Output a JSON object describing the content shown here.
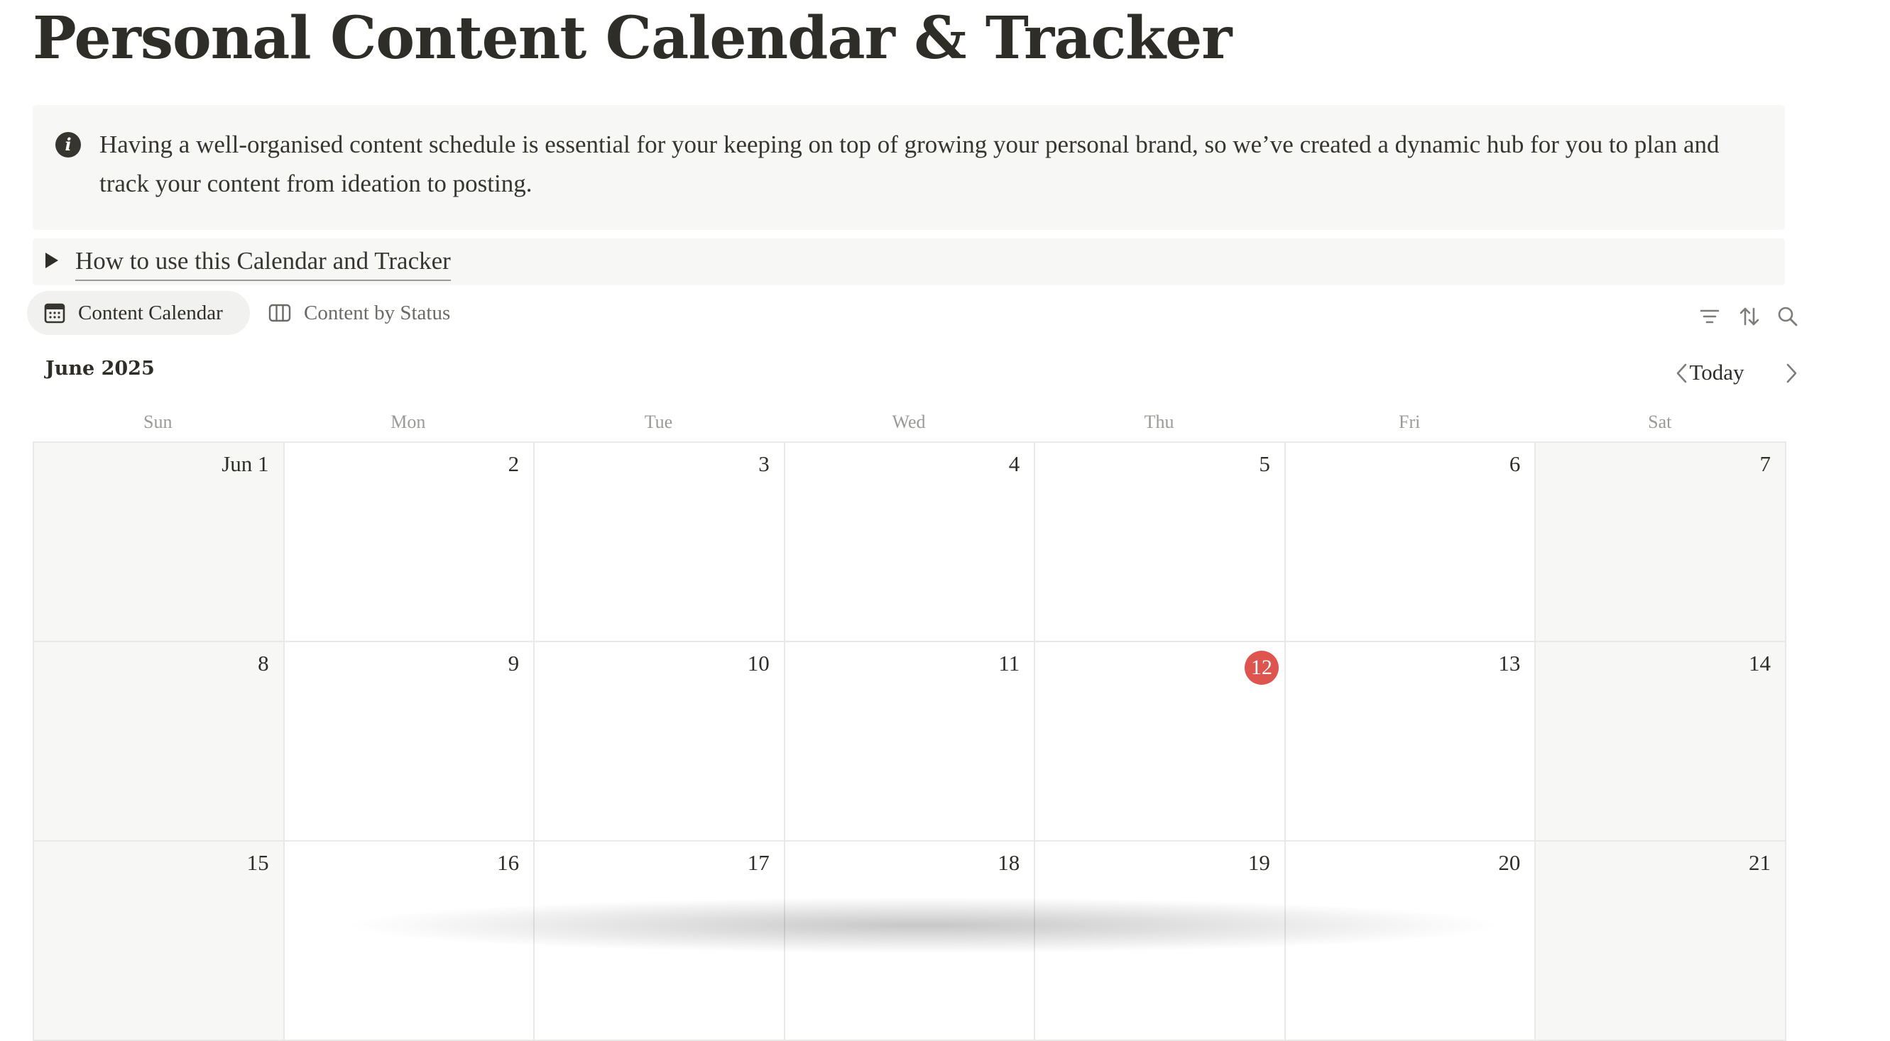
{
  "page": {
    "title": "Personal Content Calendar & Tracker"
  },
  "callout": {
    "icon": "info-icon",
    "text": "Having a well-organised content schedule is essential for your keeping on top of growing your personal brand, so we’ve created a dynamic hub for you to plan and track your content from ideation to posting."
  },
  "toggle": {
    "label": "How to use this Calendar and Tracker"
  },
  "views": {
    "tabs": [
      {
        "label": "Content Calendar",
        "icon": "calendar-icon",
        "active": true
      },
      {
        "label": "Content by Status",
        "icon": "board-columns-icon",
        "active": false
      }
    ],
    "toolbar": [
      "filter-icon",
      "sort-icon",
      "search-icon"
    ]
  },
  "calendar": {
    "month_label": "June 2025",
    "today_label": "Today",
    "weekdays": [
      "Sun",
      "Mon",
      "Tue",
      "Wed",
      "Thu",
      "Fri",
      "Sat"
    ],
    "today": "12",
    "accent_color": "#de5550",
    "weeks": [
      [
        "Jun 1",
        "2",
        "3",
        "4",
        "5",
        "6",
        "7"
      ],
      [
        "8",
        "9",
        "10",
        "11",
        "12",
        "13",
        "14"
      ],
      [
        "15",
        "16",
        "17",
        "18",
        "19",
        "20",
        "21"
      ]
    ]
  }
}
